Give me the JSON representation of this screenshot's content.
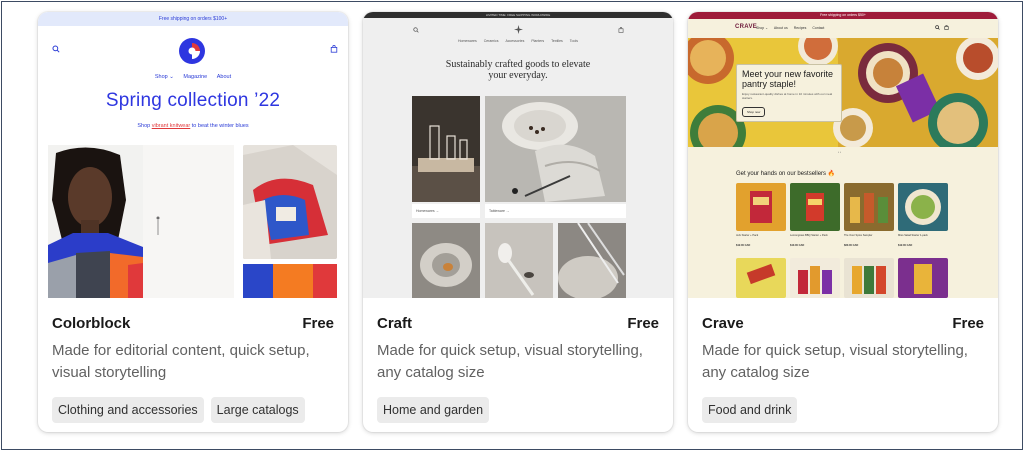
{
  "themes": [
    {
      "name": "Colorblock",
      "price": "Free",
      "description": "Made for editorial content, quick setup, visual storytelling",
      "tags": [
        "Clothing and accessories",
        "Large catalogs"
      ],
      "preview": {
        "banner": "Free shipping on orders $100+",
        "nav": [
          "Shop ⌄",
          "Magazine",
          "About"
        ],
        "headline": "Spring collection ’22",
        "sub_prefix": "Shop ",
        "sub_link": "vibrant knitwear",
        "sub_suffix": " to beat the winter blues"
      }
    },
    {
      "name": "Craft",
      "price": "Free",
      "description": "Made for quick setup, visual storytelling, any catalog size",
      "tags": [
        "Home and garden"
      ],
      "preview": {
        "banner": "LIMITED TIME: FREE SHIPPING WORLDWIDE",
        "nav": [
          "Homewares",
          "Ceramics",
          "Accessories",
          "Planters",
          "Textiles",
          "Tools"
        ],
        "headline_line1": "Sustainably crafted goods to elevate",
        "headline_line2": "your everyday.",
        "label1": "Homewares →",
        "label2": "Tableware →"
      }
    },
    {
      "name": "Crave",
      "price": "Free",
      "description": "Made for quick setup, visual storytelling, any catalog size",
      "tags": [
        "Food and drink"
      ],
      "preview": {
        "banner": "Free shipping on orders $50+",
        "logo": "CRAVE",
        "nav": [
          "Shop ⌄",
          "About us",
          "Recipes",
          "Contact"
        ],
        "hero_title": "Meet your new favorite pantry staple!",
        "hero_sub": "Enjoy restaurant-quality dishes at home in 10 minutes with our meal starters.",
        "hero_button": "Shop now",
        "dots": "• •",
        "bestsellers": "Get your hands on our bestsellers 🔥",
        "products": [
          {
            "name": "Jerk Starter + Pack",
            "price": "$12.00 CAD"
          },
          {
            "name": "Lemongrass BBQ Starter + Pack",
            "price": "$10.00 CAD"
          },
          {
            "name": "The Over Spice Sampler",
            "price": "$60.00 CAD"
          },
          {
            "name": "Miso Salad Starter 1-pack",
            "price": "$12.00 CAD"
          }
        ]
      }
    }
  ],
  "colors": {
    "frame": "#3d4b63",
    "colorblock_blue": "#2e36e0",
    "colorblock_red": "#e0393b",
    "crave_maroon": "#9e1b3a",
    "tag_bg": "#ebebeb"
  },
  "icons": [
    "search-icon",
    "cart-icon",
    "colorblock-logo-icon",
    "craft-logo-icon"
  ]
}
